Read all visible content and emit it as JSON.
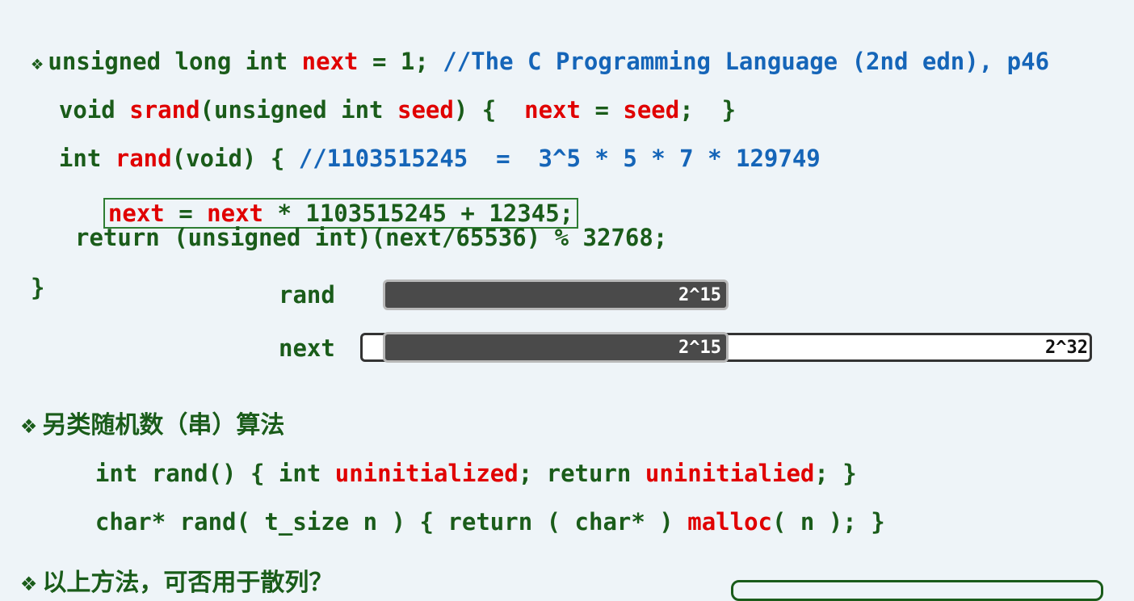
{
  "code": {
    "line1": {
      "bullet": "❖",
      "kw": "unsigned long int ",
      "var": "next",
      "rest": " = 1; ",
      "comment": "//The C Programming Language (2nd edn), p46"
    },
    "line2": {
      "kw": "void ",
      "fn": "srand",
      "args_open": "(unsigned int ",
      "arg": "seed",
      "body_open": ") {  ",
      "var": "next",
      "eq": " = ",
      "val": "seed",
      "body_close": ";  }"
    },
    "line3": {
      "kw": "int ",
      "fn": "rand",
      "rest": "(void) { ",
      "comment": "//1103515245  =  3^5 * 5 * 7 * 129749"
    },
    "line4": {
      "var1": "next",
      "eq": " = ",
      "var2": "next",
      "rest": " * 1103515245 + 12345;"
    },
    "line5": "return (unsigned int)(next/65536) % 32768;",
    "line6": "}"
  },
  "bits": {
    "rand_label": "rand",
    "next_label": "next",
    "rand_bits": "2^15",
    "next_low_bits": "2^15",
    "next_total_bits": "2^32"
  },
  "section2": {
    "bullet": "❖",
    "heading": "另类随机数（串）算法",
    "line1": {
      "pre": "int rand() { int ",
      "var": "uninitialized",
      "mid": "; return ",
      "var2": "uninitialied",
      "post": "; }"
    },
    "line2": {
      "pre": "char* rand( t_size n ) { return ( char* ) ",
      "fn": "malloc",
      "post": "( n ); }"
    }
  },
  "section3": {
    "bullet": "❖",
    "heading": "以上方法，可否用于散列？"
  }
}
